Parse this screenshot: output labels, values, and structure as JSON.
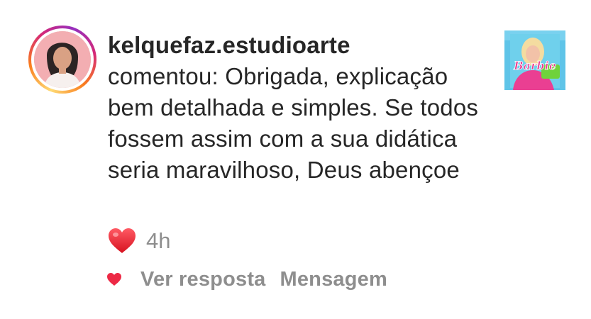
{
  "notification": {
    "username": "kelquefaz.estudioarte",
    "comment_text": "comentou: Obrigada, explicação bem detalhada e simples. Se todos fossem assim com a sua didática seria maravilhoso, Deus abençoe",
    "reaction_icon": "red-heart-emoji",
    "timestamp": "4h",
    "like_icon": "heart-icon",
    "like_color": "#ed2945",
    "actions": {
      "view_reply": "Ver resposta",
      "message": "Mensagem"
    },
    "post_thumbnail": {
      "text": "Barbie",
      "primary_color": "#e93b8f",
      "background_color": "#5fc4e8"
    }
  }
}
